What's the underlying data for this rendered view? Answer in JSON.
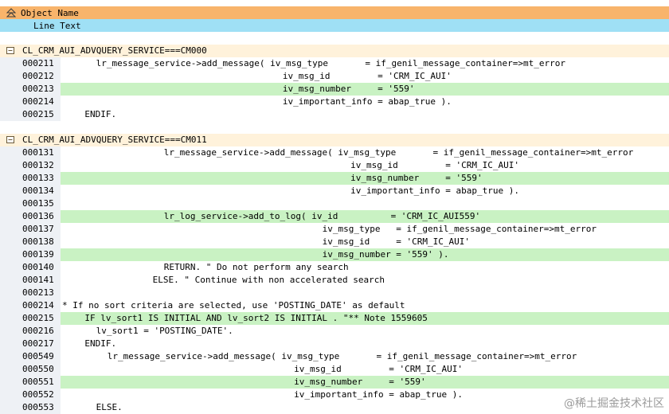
{
  "header": {
    "col1": "Object Name",
    "col2": "Line Text"
  },
  "sections": [
    {
      "title": "CL_CRM_AUI_ADVQUERY_SERVICE===CM000",
      "lines": [
        {
          "num": "000211",
          "text": "lr_message_service->add_message( iv_msg_type       = if_genil_message_container=>mt_error",
          "indent": 6,
          "hl": false
        },
        {
          "num": "000212",
          "text": "iv_msg_id         = 'CRM_IC_AUI'",
          "indent": 39,
          "hl": false
        },
        {
          "num": "000213",
          "text": "iv_msg_number     = '559'",
          "indent": 39,
          "hl": true
        },
        {
          "num": "000214",
          "text": "iv_important_info = abap_true ).",
          "indent": 39,
          "hl": false
        },
        {
          "num": "000215",
          "text": "ENDIF.",
          "indent": 4,
          "hl": false
        }
      ]
    },
    {
      "title": "CL_CRM_AUI_ADVQUERY_SERVICE===CM011",
      "lines": [
        {
          "num": "000131",
          "text": "lr_message_service->add_message( iv_msg_type       = if_genil_message_container=>mt_error",
          "indent": 18,
          "hl": false
        },
        {
          "num": "000132",
          "text": "iv_msg_id         = 'CRM_IC_AUI'",
          "indent": 51,
          "hl": false
        },
        {
          "num": "000133",
          "text": "iv_msg_number     = '559'",
          "indent": 51,
          "hl": true
        },
        {
          "num": "000134",
          "text": "iv_important_info = abap_true ).",
          "indent": 51,
          "hl": false
        },
        {
          "num": "000135",
          "text": "",
          "indent": 0,
          "hl": false
        },
        {
          "num": "000136",
          "text": "lr_log_service->add_to_log( iv_id          = 'CRM_IC_AUI559'",
          "indent": 18,
          "hl": true
        },
        {
          "num": "000137",
          "text": "iv_msg_type   = if_genil_message_container=>mt_error",
          "indent": 46,
          "hl": false
        },
        {
          "num": "000138",
          "text": "iv_msg_id     = 'CRM_IC_AUI'",
          "indent": 46,
          "hl": false
        },
        {
          "num": "000139",
          "text": "iv_msg_number = '559' ).",
          "indent": 46,
          "hl": true
        },
        {
          "num": "000140",
          "text": "RETURN. \" Do not perform any search",
          "indent": 18,
          "hl": false
        },
        {
          "num": "000141",
          "text": "ELSE. \" Continue with non accelerated search",
          "indent": 16,
          "hl": false
        },
        {
          "num": "000213",
          "text": "",
          "indent": 0,
          "hl": false
        },
        {
          "num": "000214",
          "text": "* If no sort criteria are selected, use 'POSTING_DATE' as default",
          "indent": 0,
          "hl": false
        },
        {
          "num": "000215",
          "text": "IF lv_sort1 IS INITIAL AND lv_sort2 IS INITIAL . \"** Note 1559605",
          "indent": 4,
          "hl": true
        },
        {
          "num": "000216",
          "text": "lv_sort1 = 'POSTING_DATE'.",
          "indent": 6,
          "hl": false
        },
        {
          "num": "000217",
          "text": "ENDIF.",
          "indent": 4,
          "hl": false
        },
        {
          "num": "000549",
          "text": "lr_message_service->add_message( iv_msg_type       = if_genil_message_container=>mt_error",
          "indent": 8,
          "hl": false
        },
        {
          "num": "000550",
          "text": "iv_msg_id         = 'CRM_IC_AUI'",
          "indent": 41,
          "hl": false
        },
        {
          "num": "000551",
          "text": "iv_msg_number     = '559'",
          "indent": 41,
          "hl": true
        },
        {
          "num": "000552",
          "text": "iv_important_info = abap_true ).",
          "indent": 41,
          "hl": false
        },
        {
          "num": "000553",
          "text": "ELSE.",
          "indent": 6,
          "hl": false
        }
      ]
    }
  ],
  "watermark": "@稀土掘金技术社区",
  "colors": {
    "header_orange": "#f8b46b",
    "header_blue": "#9fe0f5",
    "highlight": "#c9f2c3",
    "section_bg": "#fff2db"
  }
}
